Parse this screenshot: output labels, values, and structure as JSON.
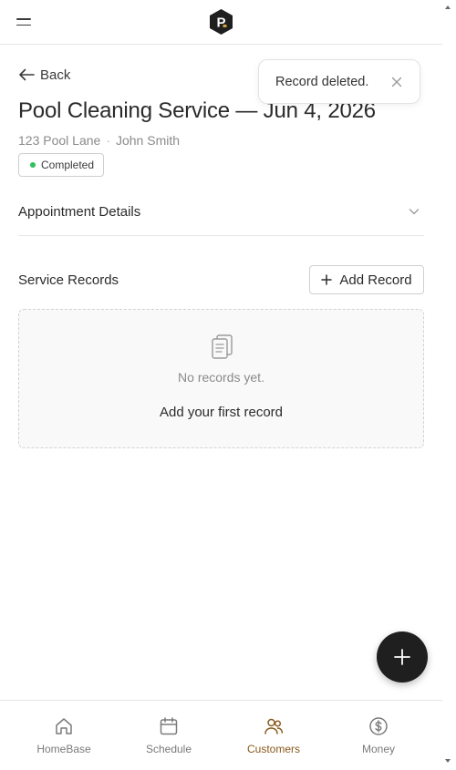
{
  "header": {
    "logo_letter": "P"
  },
  "back": {
    "label": "Back"
  },
  "toast": {
    "message": "Record deleted."
  },
  "appointment": {
    "title": "Pool Cleaning Service — Jun 4, 2026",
    "address": "123 Pool Lane",
    "separator": "·",
    "customer": "John Smith",
    "status": "Completed",
    "status_color": "#2fbf5b"
  },
  "details": {
    "label": "Appointment Details"
  },
  "records": {
    "title": "Service Records",
    "add_label": "Add Record",
    "empty_text": "No records yet.",
    "empty_action": "Add your first record"
  },
  "nav": {
    "items": [
      {
        "label": "HomeBase",
        "icon": "home-icon"
      },
      {
        "label": "Schedule",
        "icon": "calendar-icon"
      },
      {
        "label": "Customers",
        "icon": "users-icon",
        "active": true
      },
      {
        "label": "Money",
        "icon": "dollar-icon"
      }
    ],
    "active_color": "#8a5a1c"
  }
}
